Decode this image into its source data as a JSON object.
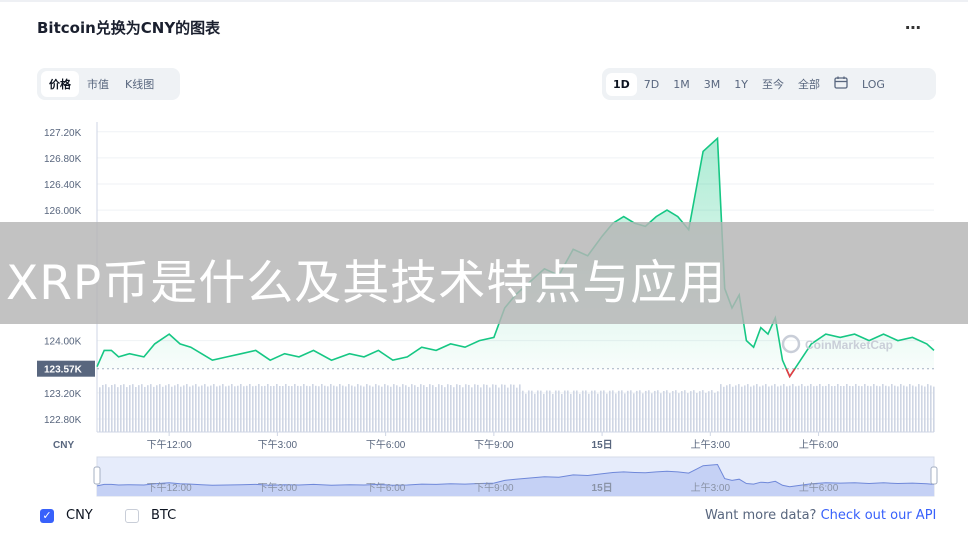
{
  "title": "Bitcoin兑换为CNY的图表",
  "more_icon": "⋯",
  "view_tabs": [
    {
      "label": "价格",
      "active": true
    },
    {
      "label": "市值",
      "active": false
    },
    {
      "label": "K线图",
      "active": false
    }
  ],
  "range_tabs": [
    {
      "label": "1D",
      "active": true
    },
    {
      "label": "7D",
      "active": false
    },
    {
      "label": "1M",
      "active": false
    },
    {
      "label": "3M",
      "active": false
    },
    {
      "label": "1Y",
      "active": false
    },
    {
      "label": "至今",
      "active": false
    },
    {
      "label": "全部",
      "active": false
    },
    {
      "label": "",
      "icon": "calendar-icon",
      "active": false
    },
    {
      "label": "LOG",
      "active": false
    }
  ],
  "banner_text": "XRP币是什么及其技术特点与应用",
  "watermark": "CoinMarketCap",
  "legend": [
    {
      "label": "CNY",
      "checked": true
    },
    {
      "label": "BTC",
      "checked": false
    }
  ],
  "api_text": "Want more data?",
  "api_link": "Check out our API",
  "colors": {
    "up": "#16c784",
    "down": "#ea3943",
    "volume": "#cfd6e4",
    "accent": "#3861fb"
  },
  "chart_data": {
    "type": "line",
    "currency_label": "CNY",
    "y_ticks": [
      127200,
      126800,
      126400,
      126000,
      124000,
      123200,
      122800
    ],
    "y_tick_labels": [
      "127.20K",
      "126.80K",
      "126.40K",
      "126.00K",
      "124.00K",
      "123.20K",
      "122.80K"
    ],
    "current_value_label": "123.57K",
    "current_value": 123570,
    "x_tick_labels": [
      "下午12:00",
      "下午3:00",
      "下午6:00",
      "下午9:00",
      "15日",
      "上午3:00",
      "上午6:00"
    ],
    "x_ticks_hours": [
      12,
      15,
      18,
      21,
      24,
      27,
      30
    ],
    "x_range_hours": [
      10.0,
      33.2
    ],
    "ylim": [
      122600,
      127350
    ],
    "series": [
      {
        "x": [
          10.0,
          10.2,
          10.4,
          10.6,
          10.9,
          11.3,
          11.6,
          12.0,
          12.3,
          12.6,
          12.9,
          13.2,
          13.6,
          14.0,
          14.4,
          14.8,
          15.2,
          15.6,
          16.0,
          16.5,
          17.0,
          17.4,
          17.8,
          18.2,
          18.6,
          19.0,
          19.4,
          19.8,
          20.2,
          20.6,
          21.0,
          21.3,
          21.6,
          22.0,
          22.4,
          22.8,
          23.2,
          23.6,
          24.0,
          24.3,
          24.6,
          24.9,
          25.2,
          25.5,
          25.8,
          26.1,
          26.4,
          26.6,
          26.8,
          27.0,
          27.2,
          27.4,
          27.6,
          27.8,
          28.0,
          28.2,
          28.4,
          28.6,
          28.8,
          29.0,
          29.2,
          29.5,
          29.8,
          30.2,
          30.6,
          31.0,
          31.4,
          31.8,
          32.2,
          32.6,
          33.0,
          33.2
        ],
        "y": [
          123600,
          123850,
          123850,
          123750,
          123800,
          123750,
          123950,
          124100,
          123950,
          123900,
          123800,
          123700,
          123750,
          123800,
          123850,
          123700,
          123800,
          123750,
          123850,
          123700,
          123800,
          123750,
          123850,
          123700,
          123750,
          123900,
          123850,
          123950,
          123900,
          124000,
          124050,
          124500,
          124700,
          124900,
          125100,
          125000,
          125400,
          125300,
          125600,
          125800,
          125900,
          125800,
          125750,
          125900,
          126000,
          125900,
          125700,
          126300,
          126900,
          127000,
          127100,
          124800,
          124500,
          124700,
          124000,
          123900,
          124200,
          124100,
          124350,
          123700,
          123450,
          123700,
          123950,
          124100,
          124050,
          124100,
          124000,
          124100,
          124000,
          124050,
          123950,
          123850
        ]
      }
    ]
  }
}
